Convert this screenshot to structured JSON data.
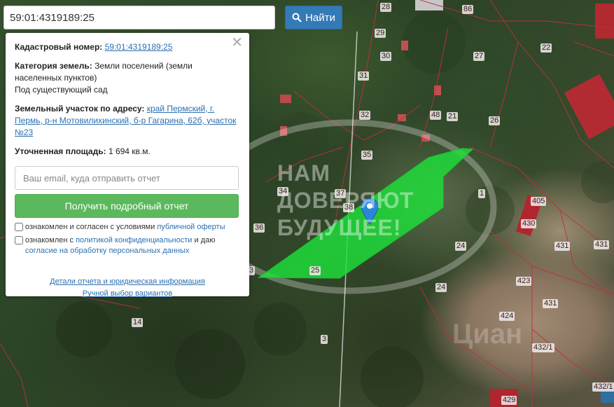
{
  "search": {
    "value": "59:01:4319189:25",
    "button_label": "Найти"
  },
  "info": {
    "cadastral_label": "Кадастровый номер:",
    "cadastral_value": "59:01:4319189:25",
    "category_label": "Категория земель:",
    "category_value": "Земли поселений (земли населенных пунктов)",
    "category_use": "Под существующий сад",
    "address_label": "Земельный участок по адресу:",
    "address_value": "край Пермский, г. Пермь, р-н Мотовилихинский, б-р Гагарина, 62б, участок №23",
    "area_label": "Уточненная площадь:",
    "area_value": "1 694 кв.м.",
    "email_placeholder": "Ваш email, куда отправить отчет",
    "report_button": "Получить подробный отчет",
    "consent1_prefix": "ознакомлен и согласен с условиями ",
    "consent1_link": "публичной оферты",
    "consent2_prefix": "ознакомлен с ",
    "consent2_link1": "политикой конфиденциальности",
    "consent2_mid": " и даю ",
    "consent2_link2": "согласие на обработку персональных данных",
    "link_details": "Детали отчета и юридическая информация",
    "link_manual": "Ручной выбор вариантов"
  },
  "map": {
    "parcel_color": "#1ee03a",
    "boundary_color": "#c0303a",
    "marker_color": "#2a86d8",
    "watermark_lines": [
      "НАМ",
      "ДОВЕРЯЮТ",
      "БУДУЩЕЕ!"
    ],
    "bottom_watermark": "Циан",
    "plot_labels": [
      "28",
      "86",
      "22",
      "29",
      "27",
      "30",
      "31",
      "32",
      "48",
      "21",
      "26",
      "35",
      "37",
      "38",
      "34",
      "36",
      "1",
      "405",
      "430",
      "24",
      "431",
      "431",
      "25",
      "24",
      "423",
      "431",
      "424",
      "14",
      "3",
      "432/1",
      "432/1",
      "429",
      "3"
    ]
  }
}
